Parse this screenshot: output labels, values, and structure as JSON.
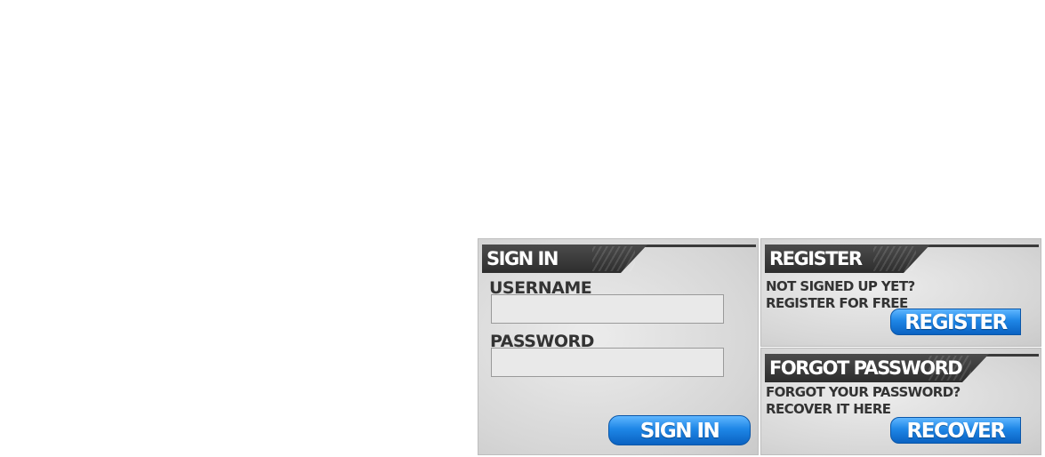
{
  "signin": {
    "title": "SIGN IN",
    "username_label": "USERNAME",
    "username_value": "",
    "password_label": "PASSWORD",
    "password_value": "",
    "button_label": "SIGN IN"
  },
  "register": {
    "title": "REGISTER",
    "line1": "NOT SIGNED UP YET?",
    "line2": "REGISTER FOR FREE",
    "button_label": "REGISTER"
  },
  "forgot": {
    "title": "FORGOT PASSWORD",
    "line1": "FORGOT YOUR PASSWORD?",
    "line2": "RECOVER IT HERE",
    "button_label": "RECOVER"
  },
  "colors": {
    "title_bar": "#333333",
    "button": "#1e86e6",
    "panel": "#d6d6d6"
  }
}
